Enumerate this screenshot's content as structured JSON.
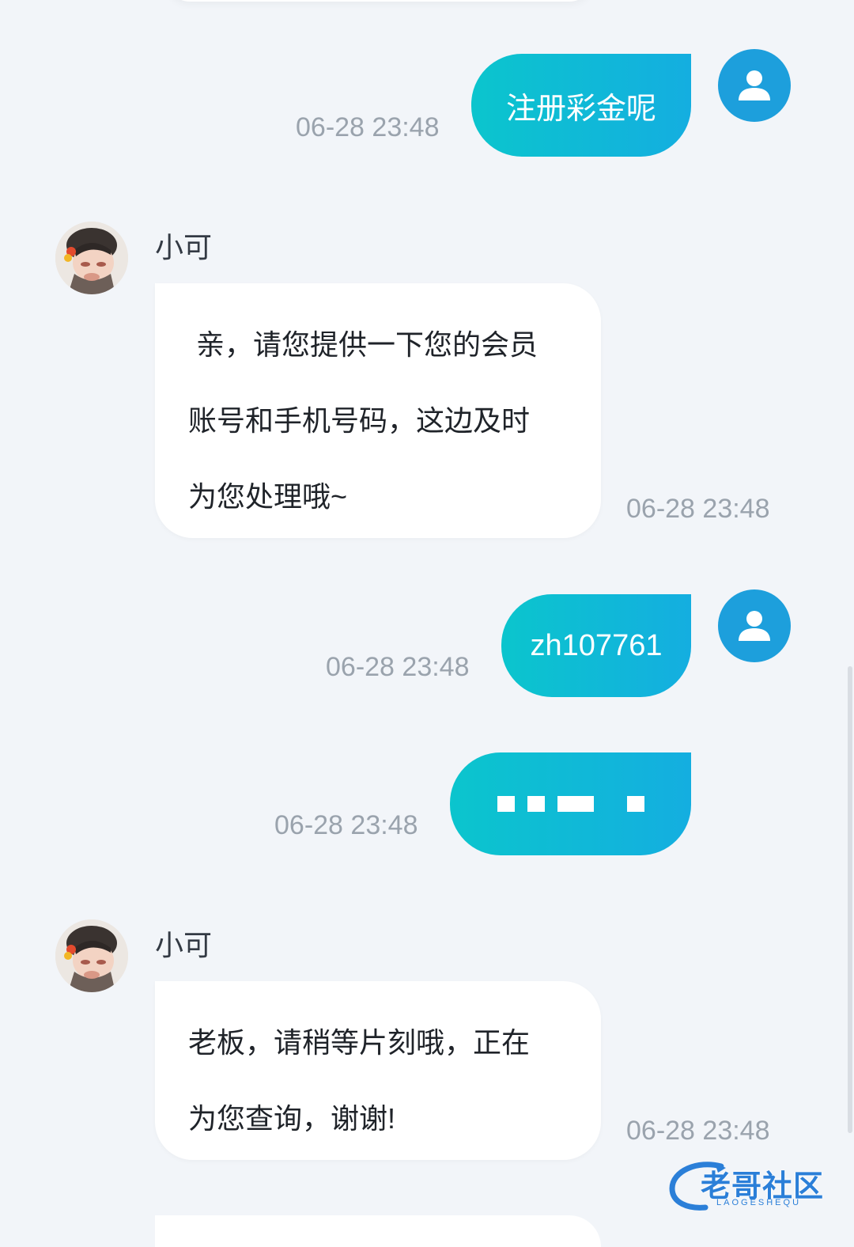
{
  "messages": [
    {
      "type": "outgoing",
      "text": "注册彩金呢",
      "time": "06-28 23:48"
    },
    {
      "type": "incoming",
      "sender": "小可",
      "lines": [
        " 亲，请您提供一下您的会员",
        "账号和手机号码，这边及时",
        "为您处理哦~"
      ],
      "time": "06-28 23:48"
    },
    {
      "type": "outgoing",
      "text": "zh107761",
      "time": "06-28 23:48"
    },
    {
      "type": "outgoing",
      "text": "",
      "masked": true,
      "time": "06-28 23:48"
    },
    {
      "type": "incoming",
      "sender": "小可",
      "lines": [
        "老板，请稍等片刻哦，正在",
        "为您查询，谢谢!"
      ],
      "time": "06-28 23:48"
    }
  ],
  "watermark": {
    "text": "老哥社区",
    "sub": "LAOGESHEQU"
  },
  "icons": {
    "user_avatar": "user-silhouette-icon",
    "agent_avatar": "profile-photo"
  },
  "colors": {
    "background": "#f2f5f9",
    "outgoing_start": "#0bc5cd",
    "outgoing_end": "#14aee0",
    "avatar_blue": "#1d9fdc",
    "timestamp": "#9aa3ad"
  }
}
